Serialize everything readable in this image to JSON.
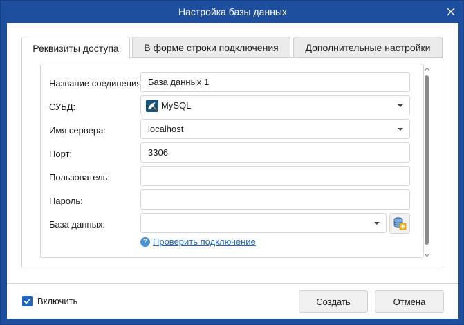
{
  "window": {
    "title": "Настройка базы данных"
  },
  "tabs": [
    {
      "label": "Реквизиты доступа",
      "active": true
    },
    {
      "label": "В форме строки подключения",
      "active": false
    },
    {
      "label": "Дополнительные настройки",
      "active": false
    }
  ],
  "form": {
    "connection_name": {
      "label": "Название соединения:",
      "value": "База данных 1"
    },
    "dbms": {
      "label": "СУБД:",
      "value": "MySQL",
      "icon": "mysql-icon"
    },
    "server": {
      "label": "Имя сервера:",
      "value": "localhost"
    },
    "port": {
      "label": "Порт:",
      "value": "3306"
    },
    "user": {
      "label": "Пользователь:",
      "value": ""
    },
    "password": {
      "label": "Пароль:",
      "value": ""
    },
    "database": {
      "label": "База данных:",
      "value": ""
    },
    "check_link": "Проверить подключение"
  },
  "footer": {
    "enable_label": "Включить",
    "enable_checked": true,
    "create_button": "Создать",
    "cancel_button": "Отмена"
  },
  "colors": {
    "titlebar": "#1e4f9e",
    "accent": "#1f66c0",
    "link": "#1f66c0"
  }
}
